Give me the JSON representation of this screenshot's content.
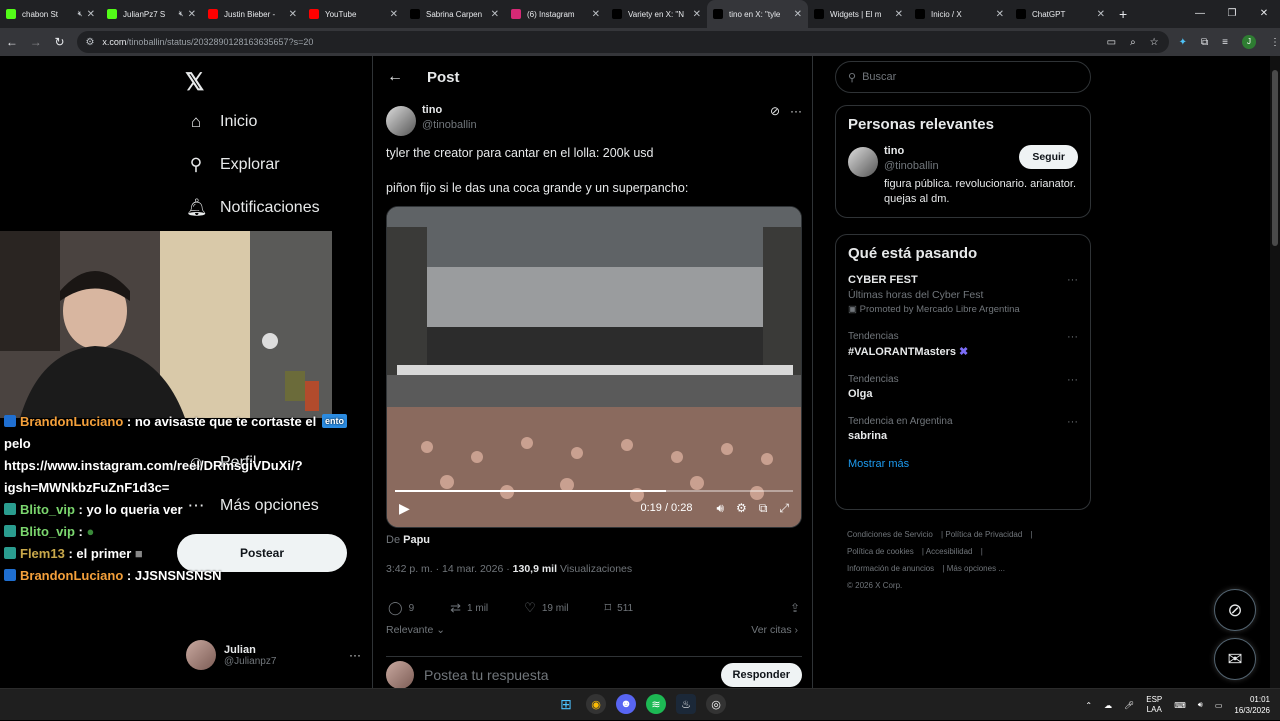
{
  "browser": {
    "tabs": [
      {
        "title": "chabon St",
        "color": "#53fc18",
        "muted": true
      },
      {
        "title": "JulianPz7 S",
        "color": "#53fc18",
        "muted": true
      },
      {
        "title": "Justin Bieber -",
        "color": "#ff0000",
        "muted": false
      },
      {
        "title": "YouTube",
        "color": "#ff0000",
        "muted": false
      },
      {
        "title": "Sabrina Carpen",
        "color": "#000000",
        "muted": false
      },
      {
        "title": "(6) Instagram",
        "color": "#d62976",
        "muted": false
      },
      {
        "title": "Variety en X: \"N",
        "color": "#000000",
        "muted": false
      },
      {
        "title": "tino en X: \"tyle",
        "color": "#000000",
        "muted": false,
        "active": true
      },
      {
        "title": "Widgets | El m",
        "color": "#000000",
        "muted": false
      },
      {
        "title": "Inicio / X",
        "color": "#000000",
        "muted": false
      },
      {
        "title": "ChatGPT",
        "color": "#000000",
        "muted": false
      }
    ],
    "url_host": "x.com",
    "url_path": "/tinoballin/status/2032890128163635657?s=20"
  },
  "nav": {
    "items": [
      {
        "label": "Inicio",
        "icon": "home-icon"
      },
      {
        "label": "Explorar",
        "icon": "search-icon"
      },
      {
        "label": "Notificaciones",
        "icon": "bell-icon"
      },
      {
        "label": "Perfil",
        "icon": "person-icon"
      },
      {
        "label": "Más opciones",
        "icon": "more-icon"
      }
    ],
    "post_button": "Postear",
    "user": {
      "name": "Julian",
      "handle": "@Julianpz7"
    }
  },
  "chat": {
    "lines": [
      {
        "user": "BrandonLuciano",
        "msg": ": no avisaste que te cortaste el",
        "color": "#f4a03b"
      },
      {
        "user": "",
        "msg": "pelo",
        "color": ""
      },
      {
        "user": "",
        "msg": "https://www.instagram.com/reel/DRmsgiVDuXi/?",
        "color": ""
      },
      {
        "user": "",
        "msg": "igsh=MWNkbzFuZnF1d3c=",
        "color": ""
      },
      {
        "user": "Blito_vip",
        "msg": ": yo lo queria ver",
        "color": "#7bd66e"
      },
      {
        "user": "Blito_vip",
        "msg": ":",
        "color": "#7bd66e"
      },
      {
        "user": "Flem13",
        "msg": ": el primer",
        "color": "#c8a84b"
      },
      {
        "user": "BrandonLuciano",
        "msg": ": JJSNSNSNSN",
        "color": "#f4a03b"
      }
    ],
    "tag": "ento"
  },
  "post": {
    "header_title": "Post",
    "author_name": "tino",
    "author_handle": "@tinoballin",
    "text1": "tyler the creator para cantar en el lolla: 200k usd",
    "text2": "piñon fijo si le das una coca grande y un superpancho:",
    "video_time": "0:19 / 0:28",
    "video_progress": 0.68,
    "from_label": "De",
    "from_name": "Papu",
    "time": "3:42 p. m. · 14 mar. 2026 ·",
    "views": "130,9 mil",
    "views_label": "Visualizaciones",
    "replies": "9",
    "reposts": "1 mil",
    "likes": "19 mil",
    "bookmarks": "511",
    "sort_label": "Relevante",
    "quotes_label": "Ver citas",
    "reply_placeholder": "Postea tu respuesta",
    "reply_button": "Responder"
  },
  "right": {
    "search_placeholder": "Buscar",
    "relevant_title": "Personas relevantes",
    "person": {
      "name": "tino",
      "handle": "@tinoballin",
      "bio": "figura pública. revolucionario. arianator. quejas al dm.",
      "follow": "Seguir"
    },
    "trending_title": "Qué está pasando",
    "trends": [
      {
        "context": "",
        "title": "CYBER FEST",
        "sub": "Últimas horas del Cyber Fest",
        "promo": "Promoted by Mercado Libre Argentina"
      },
      {
        "context": "Tendencias",
        "title": "#VALORANTMasters",
        "sub": "",
        "promo": ""
      },
      {
        "context": "Tendencias",
        "title": "Olga",
        "sub": "",
        "promo": ""
      },
      {
        "context": "Tendencia en Argentina",
        "title": "sabrina",
        "sub": "",
        "promo": ""
      }
    ],
    "show_more": "Mostrar más",
    "footer": [
      "Condiciones de Servicio",
      "Política de Privacidad",
      "Política de cookies",
      "Accesibilidad",
      "Información de anuncios",
      "Más opciones ...",
      "© 2026 X Corp."
    ]
  },
  "taskbar": {
    "lang1": "ESP",
    "lang2": "LAA",
    "time": "01:01",
    "date": "16/3/2026"
  }
}
